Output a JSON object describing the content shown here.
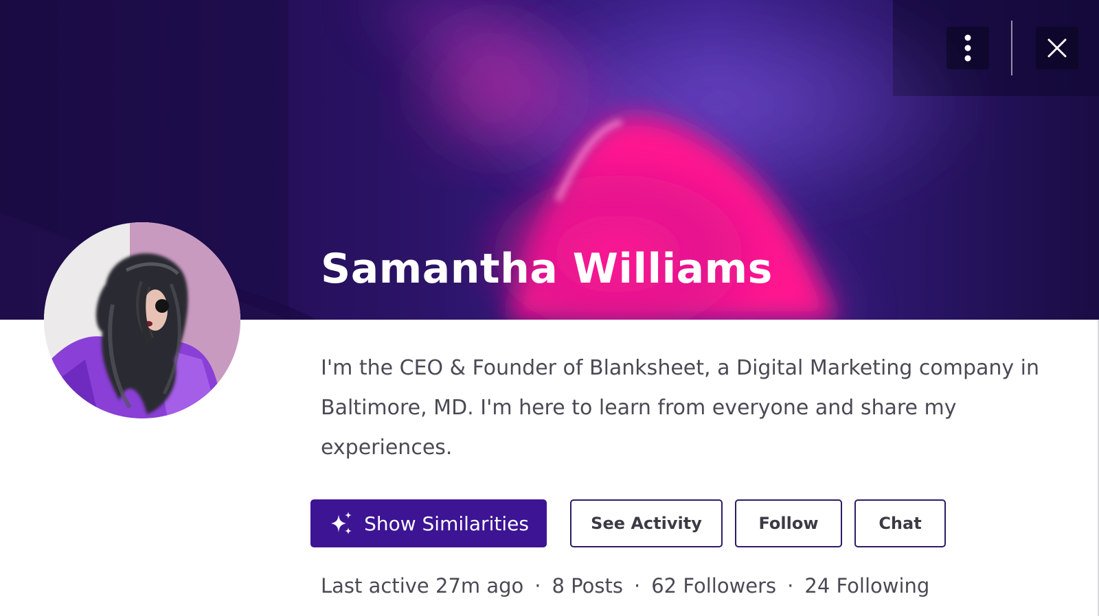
{
  "profile": {
    "name": "Samantha Williams",
    "bio": "I'm the CEO & Founder of Blanksheet, a Digital Marketing company in Baltimore, MD. I'm here to learn from everyone and share my experiences."
  },
  "header_controls": {
    "more_icon": "vertical-dots-icon",
    "close_icon": "close-icon"
  },
  "actions": {
    "show_similarities": "Show Similarities",
    "show_similarities_icon": "sparkle-icon",
    "see_activity": "See Activity",
    "follow": "Follow",
    "chat": "Chat"
  },
  "stats": {
    "last_active": "Last active 27m ago",
    "posts": "8 Posts",
    "followers": "62 Followers",
    "following": "24 Following",
    "separator": "·"
  },
  "colors": {
    "primary": "#3d1494",
    "banner_dark": "#1c0b48",
    "banner_pink": "#ff1493",
    "text": "#4a4a55"
  }
}
